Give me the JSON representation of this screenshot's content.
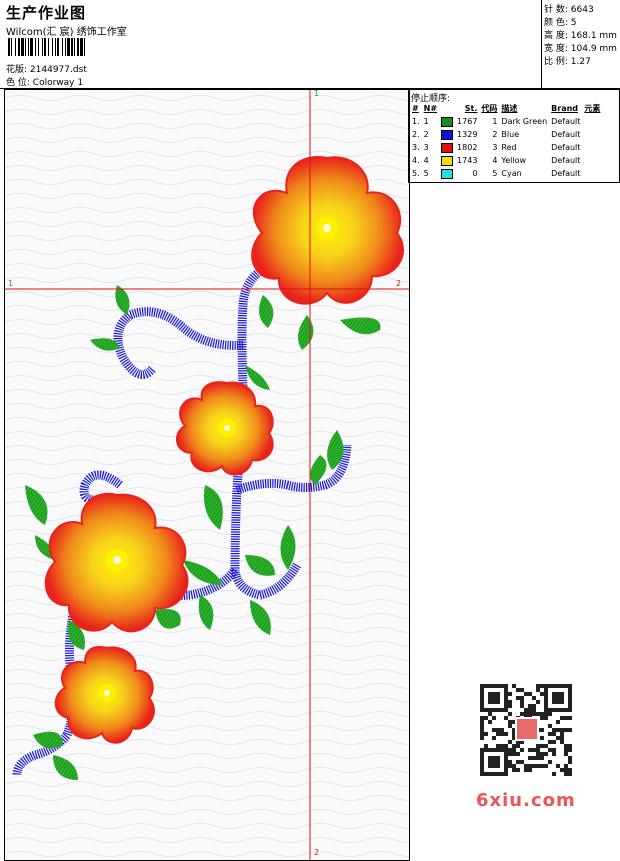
{
  "header": {
    "title": "生产作业图",
    "subtitle": "Wilcom(汇 宸) 绣饰工作室",
    "file_label": "花版:",
    "file_name": "2144977.dst",
    "colorway_label": "色 位:",
    "colorway_name": "Colorway 1"
  },
  "stats": [
    {
      "label": "针 数:",
      "value": "6643"
    },
    {
      "label": "颜 色:",
      "value": "5"
    },
    {
      "label": "高 度:",
      "value": "168.1 mm"
    },
    {
      "label": "宽 度:",
      "value": "104.9 mm"
    },
    {
      "label": "比 例:",
      "value": "1.27"
    }
  ],
  "stop_sequence": {
    "title": "停止顺序:",
    "columns": [
      "#",
      "N#",
      "St.",
      "代码",
      "描述",
      "Brand",
      "元素"
    ],
    "rows": [
      {
        "index": "1.",
        "n": "1",
        "color": "#109010",
        "stitches": "1767",
        "code": "1",
        "desc": "Dark Green",
        "brand": "Default"
      },
      {
        "index": "2.",
        "n": "2",
        "color": "#1010e0",
        "stitches": "1329",
        "code": "2",
        "desc": "Blue",
        "brand": "Default"
      },
      {
        "index": "3.",
        "n": "3",
        "color": "#e01010",
        "stitches": "1802",
        "code": "3",
        "desc": "Red",
        "brand": "Default"
      },
      {
        "index": "4.",
        "n": "4",
        "color": "#f0e000",
        "stitches": "1743",
        "code": "4",
        "desc": "Yellow",
        "brand": "Default"
      },
      {
        "index": "5.",
        "n": "5",
        "color": "#20e0e0",
        "stitches": "0",
        "code": "5",
        "desc": "Cyan",
        "brand": "Default"
      }
    ]
  },
  "guides": {
    "h_left": "1",
    "h_right": "2",
    "v_top": "1",
    "v_bottom": "2"
  },
  "watermark": "6xiu.com",
  "colors": {
    "green": "#13a313",
    "blue": "#1414e0",
    "red": "#ee1a1a",
    "yellow": "#f4f000",
    "orange": "#f39a1a",
    "guide": "#e01010"
  }
}
